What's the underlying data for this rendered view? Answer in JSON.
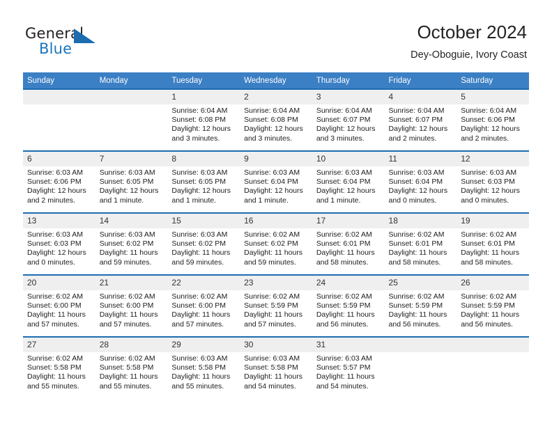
{
  "brand": {
    "word1": "General",
    "word2": "Blue",
    "logo_icon": "triangle-logo-icon",
    "accent_color": "#1b6cb0"
  },
  "header": {
    "title": "October 2024",
    "subtitle": "Dey-Oboguie, Ivory Coast"
  },
  "calendar": {
    "header_bg": "#3b7fc4",
    "row_divider_color": "#1b6cb0",
    "daynum_bg": "#efefef",
    "weekdays": [
      "Sunday",
      "Monday",
      "Tuesday",
      "Wednesday",
      "Thursday",
      "Friday",
      "Saturday"
    ],
    "weeks": [
      [
        {
          "day": "",
          "sunrise": "",
          "sunset": "",
          "daylight": ""
        },
        {
          "day": "",
          "sunrise": "",
          "sunset": "",
          "daylight": ""
        },
        {
          "day": "1",
          "sunrise": "Sunrise: 6:04 AM",
          "sunset": "Sunset: 6:08 PM",
          "daylight": "Daylight: 12 hours and 3 minutes."
        },
        {
          "day": "2",
          "sunrise": "Sunrise: 6:04 AM",
          "sunset": "Sunset: 6:08 PM",
          "daylight": "Daylight: 12 hours and 3 minutes."
        },
        {
          "day": "3",
          "sunrise": "Sunrise: 6:04 AM",
          "sunset": "Sunset: 6:07 PM",
          "daylight": "Daylight: 12 hours and 3 minutes."
        },
        {
          "day": "4",
          "sunrise": "Sunrise: 6:04 AM",
          "sunset": "Sunset: 6:07 PM",
          "daylight": "Daylight: 12 hours and 2 minutes."
        },
        {
          "day": "5",
          "sunrise": "Sunrise: 6:04 AM",
          "sunset": "Sunset: 6:06 PM",
          "daylight": "Daylight: 12 hours and 2 minutes."
        }
      ],
      [
        {
          "day": "6",
          "sunrise": "Sunrise: 6:03 AM",
          "sunset": "Sunset: 6:06 PM",
          "daylight": "Daylight: 12 hours and 2 minutes."
        },
        {
          "day": "7",
          "sunrise": "Sunrise: 6:03 AM",
          "sunset": "Sunset: 6:05 PM",
          "daylight": "Daylight: 12 hours and 1 minute."
        },
        {
          "day": "8",
          "sunrise": "Sunrise: 6:03 AM",
          "sunset": "Sunset: 6:05 PM",
          "daylight": "Daylight: 12 hours and 1 minute."
        },
        {
          "day": "9",
          "sunrise": "Sunrise: 6:03 AM",
          "sunset": "Sunset: 6:04 PM",
          "daylight": "Daylight: 12 hours and 1 minute."
        },
        {
          "day": "10",
          "sunrise": "Sunrise: 6:03 AM",
          "sunset": "Sunset: 6:04 PM",
          "daylight": "Daylight: 12 hours and 1 minute."
        },
        {
          "day": "11",
          "sunrise": "Sunrise: 6:03 AM",
          "sunset": "Sunset: 6:04 PM",
          "daylight": "Daylight: 12 hours and 0 minutes."
        },
        {
          "day": "12",
          "sunrise": "Sunrise: 6:03 AM",
          "sunset": "Sunset: 6:03 PM",
          "daylight": "Daylight: 12 hours and 0 minutes."
        }
      ],
      [
        {
          "day": "13",
          "sunrise": "Sunrise: 6:03 AM",
          "sunset": "Sunset: 6:03 PM",
          "daylight": "Daylight: 12 hours and 0 minutes."
        },
        {
          "day": "14",
          "sunrise": "Sunrise: 6:03 AM",
          "sunset": "Sunset: 6:02 PM",
          "daylight": "Daylight: 11 hours and 59 minutes."
        },
        {
          "day": "15",
          "sunrise": "Sunrise: 6:03 AM",
          "sunset": "Sunset: 6:02 PM",
          "daylight": "Daylight: 11 hours and 59 minutes."
        },
        {
          "day": "16",
          "sunrise": "Sunrise: 6:02 AM",
          "sunset": "Sunset: 6:02 PM",
          "daylight": "Daylight: 11 hours and 59 minutes."
        },
        {
          "day": "17",
          "sunrise": "Sunrise: 6:02 AM",
          "sunset": "Sunset: 6:01 PM",
          "daylight": "Daylight: 11 hours and 58 minutes."
        },
        {
          "day": "18",
          "sunrise": "Sunrise: 6:02 AM",
          "sunset": "Sunset: 6:01 PM",
          "daylight": "Daylight: 11 hours and 58 minutes."
        },
        {
          "day": "19",
          "sunrise": "Sunrise: 6:02 AM",
          "sunset": "Sunset: 6:01 PM",
          "daylight": "Daylight: 11 hours and 58 minutes."
        }
      ],
      [
        {
          "day": "20",
          "sunrise": "Sunrise: 6:02 AM",
          "sunset": "Sunset: 6:00 PM",
          "daylight": "Daylight: 11 hours and 57 minutes."
        },
        {
          "day": "21",
          "sunrise": "Sunrise: 6:02 AM",
          "sunset": "Sunset: 6:00 PM",
          "daylight": "Daylight: 11 hours and 57 minutes."
        },
        {
          "day": "22",
          "sunrise": "Sunrise: 6:02 AM",
          "sunset": "Sunset: 6:00 PM",
          "daylight": "Daylight: 11 hours and 57 minutes."
        },
        {
          "day": "23",
          "sunrise": "Sunrise: 6:02 AM",
          "sunset": "Sunset: 5:59 PM",
          "daylight": "Daylight: 11 hours and 57 minutes."
        },
        {
          "day": "24",
          "sunrise": "Sunrise: 6:02 AM",
          "sunset": "Sunset: 5:59 PM",
          "daylight": "Daylight: 11 hours and 56 minutes."
        },
        {
          "day": "25",
          "sunrise": "Sunrise: 6:02 AM",
          "sunset": "Sunset: 5:59 PM",
          "daylight": "Daylight: 11 hours and 56 minutes."
        },
        {
          "day": "26",
          "sunrise": "Sunrise: 6:02 AM",
          "sunset": "Sunset: 5:59 PM",
          "daylight": "Daylight: 11 hours and 56 minutes."
        }
      ],
      [
        {
          "day": "27",
          "sunrise": "Sunrise: 6:02 AM",
          "sunset": "Sunset: 5:58 PM",
          "daylight": "Daylight: 11 hours and 55 minutes."
        },
        {
          "day": "28",
          "sunrise": "Sunrise: 6:02 AM",
          "sunset": "Sunset: 5:58 PM",
          "daylight": "Daylight: 11 hours and 55 minutes."
        },
        {
          "day": "29",
          "sunrise": "Sunrise: 6:03 AM",
          "sunset": "Sunset: 5:58 PM",
          "daylight": "Daylight: 11 hours and 55 minutes."
        },
        {
          "day": "30",
          "sunrise": "Sunrise: 6:03 AM",
          "sunset": "Sunset: 5:58 PM",
          "daylight": "Daylight: 11 hours and 54 minutes."
        },
        {
          "day": "31",
          "sunrise": "Sunrise: 6:03 AM",
          "sunset": "Sunset: 5:57 PM",
          "daylight": "Daylight: 11 hours and 54 minutes."
        },
        {
          "day": "",
          "sunrise": "",
          "sunset": "",
          "daylight": ""
        },
        {
          "day": "",
          "sunrise": "",
          "sunset": "",
          "daylight": ""
        }
      ]
    ]
  }
}
